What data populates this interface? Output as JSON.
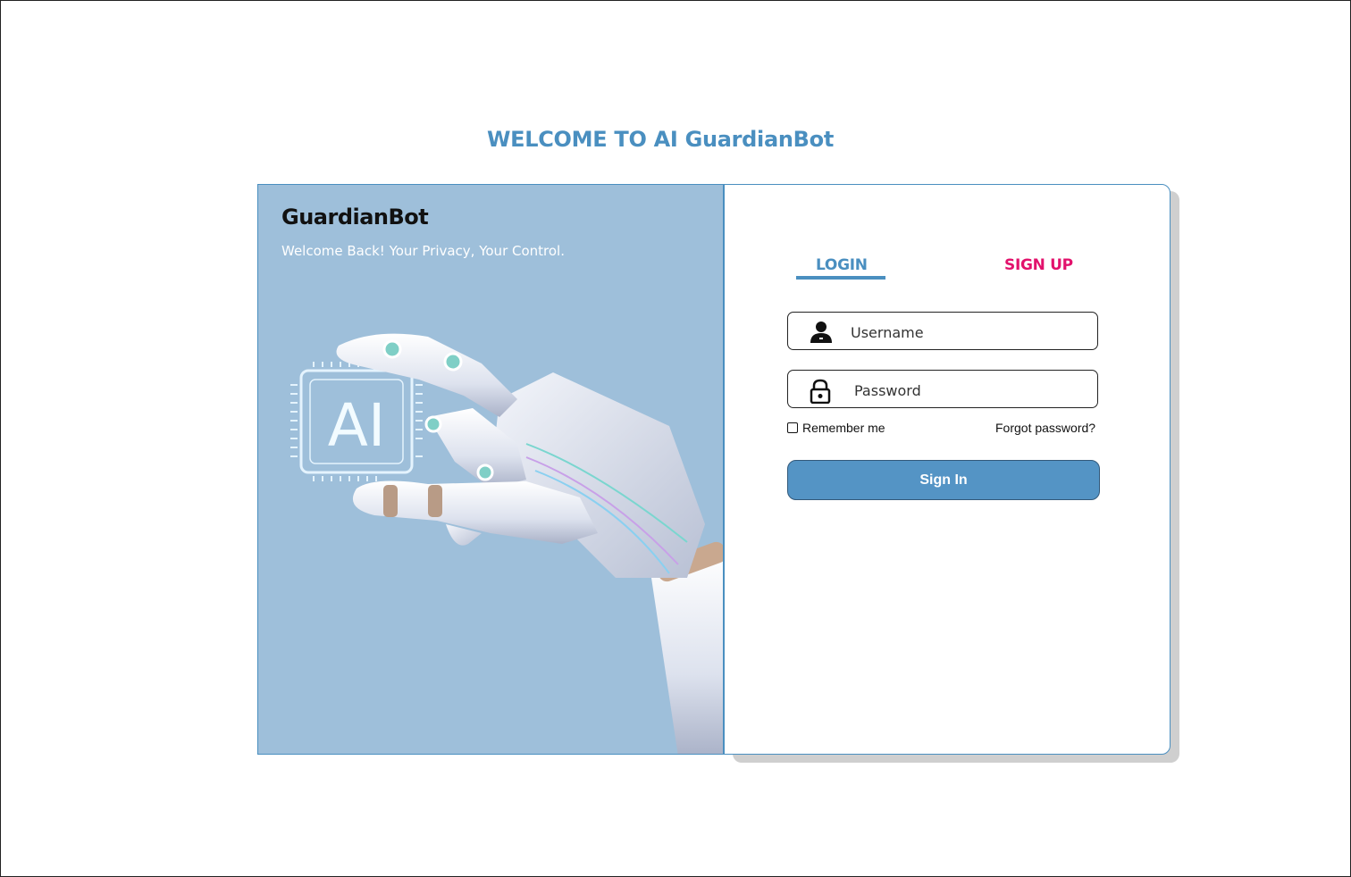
{
  "page": {
    "title": "WELCOME TO AI GuardianBot"
  },
  "hero": {
    "brand": "GuardianBot",
    "tagline": "Welcome Back! Your Privacy, Your Control.",
    "chip_text": "AI"
  },
  "auth": {
    "tabs": [
      {
        "label": "LOGIN",
        "active": true
      },
      {
        "label": "SIGN UP",
        "active": false
      }
    ],
    "username": {
      "placeholder": "Username",
      "value": "",
      "icon": "user-icon"
    },
    "password": {
      "placeholder": "Password",
      "value": "",
      "icon": "lock-icon"
    },
    "remember_label": "Remember me",
    "remember_checked": false,
    "forgot_label": "Forgot password?",
    "submit_label": "Sign In"
  },
  "colors": {
    "accent": "#4a8fc0",
    "signup": "#e2126c",
    "hero_bg": "#9ebfda",
    "button": "#5494c5"
  }
}
